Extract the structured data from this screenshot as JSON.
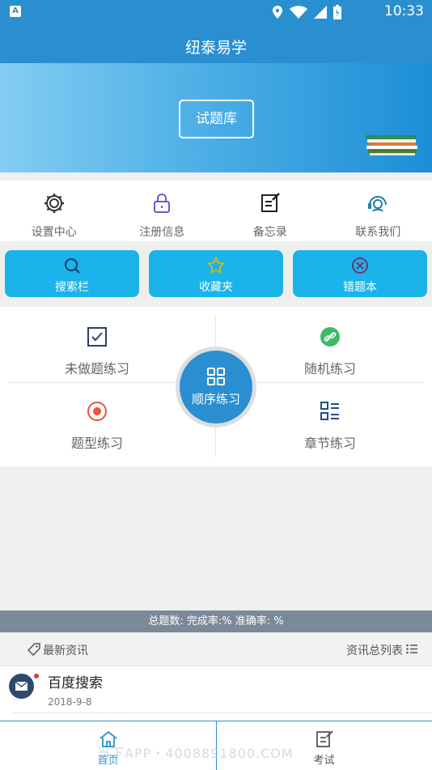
{
  "status_bar": {
    "time": "10:33"
  },
  "app": {
    "title": "纽泰易学"
  },
  "banner": {
    "button_label": "试题库"
  },
  "quick_menu": [
    {
      "label": "设置中心",
      "icon": "gear-icon"
    },
    {
      "label": "注册信息",
      "icon": "lock-icon"
    },
    {
      "label": "备忘录",
      "icon": "edit-note-icon"
    },
    {
      "label": "联系我们",
      "icon": "headset-icon"
    }
  ],
  "tools": [
    {
      "label": "搜索栏",
      "icon": "search-icon"
    },
    {
      "label": "收藏夹",
      "icon": "star-icon"
    },
    {
      "label": "错题本",
      "icon": "error-circle-icon"
    }
  ],
  "practice": {
    "top_left": "未做题练习",
    "top_right": "随机练习",
    "bottom_left": "题型练习",
    "bottom_right": "章节练习",
    "center": "顺序练习"
  },
  "stats": {
    "text": "总题数:   完成率:%    准确率:  %"
  },
  "news_header": {
    "left": "最新资讯",
    "right": "资讯总列表"
  },
  "news": [
    {
      "title": "百度搜索",
      "date": "2018-9-8"
    }
  ],
  "tabs": [
    {
      "label": "首页"
    },
    {
      "label": "考试"
    }
  ],
  "watermark": "当下APP・4008891800.COM",
  "colors": {
    "primary": "#2a8fd0",
    "tool_bg": "#1ab4ea",
    "stats_bg": "#7a8a99"
  }
}
